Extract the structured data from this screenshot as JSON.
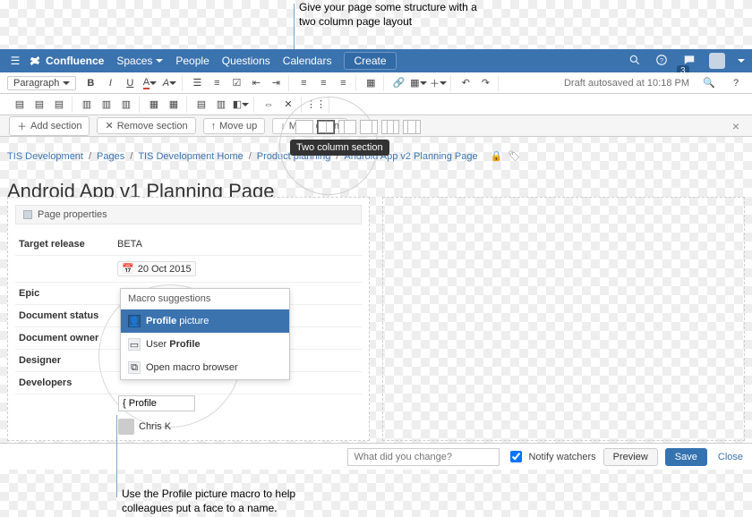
{
  "callouts": {
    "top": "Give your page some structure with a two column page layout",
    "bottom": "Use the Profile picture macro to help colleagues put a face to a name."
  },
  "nav": {
    "brand": "Confluence",
    "menu": [
      "Spaces",
      "People",
      "Questions",
      "Calendars"
    ],
    "create": "Create",
    "notif_count": "3"
  },
  "toolbar": {
    "paragraph": "Paragraph",
    "autosave": "Draft autosaved at 10:18 PM"
  },
  "layoutbar": {
    "add": "Add section",
    "remove": "Remove section",
    "up": "Move up",
    "down": "Move down",
    "tooltip": "Two column section"
  },
  "crumbs": [
    "TIS Development",
    "Pages",
    "TIS Development Home",
    "Product planning",
    "Android App v2 Planning Page"
  ],
  "page_title": "Android App v1 Planning Page",
  "page_props": {
    "header": "Page properties",
    "rows": [
      {
        "k": "Target release",
        "v": "BETA"
      },
      {
        "k": "",
        "v": "20 Oct 2015"
      },
      {
        "k": "Epic",
        "v": ""
      },
      {
        "k": "Document status",
        "v": ""
      },
      {
        "k": "Document owner",
        "v": ""
      },
      {
        "k": "Designer",
        "v": ""
      },
      {
        "k": "Developers",
        "v": ""
      }
    ]
  },
  "macro": {
    "head": "Macro suggestions",
    "items": [
      {
        "label_strong": "Profile",
        "label_rest": " picture",
        "sel": true
      },
      {
        "label_strong": "",
        "label_rest": "User Profile",
        "sel": false
      },
      {
        "label_strong": "",
        "label_rest": "Open macro browser",
        "sel": false
      }
    ],
    "input_value": "{ Profile"
  },
  "developer_name": "Chris K",
  "footer": {
    "placeholder": "What did you change?",
    "notify": "Notify watchers",
    "preview": "Preview",
    "save": "Save",
    "close": "Close"
  }
}
